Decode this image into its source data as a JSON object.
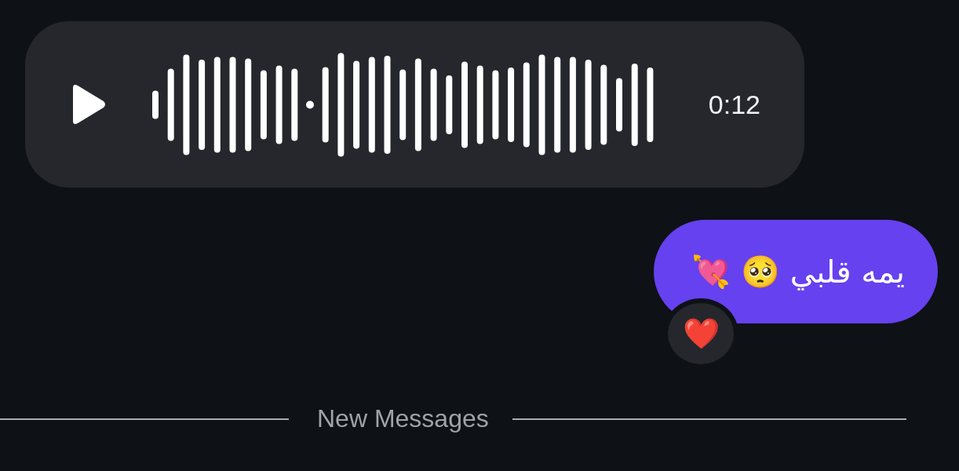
{
  "voice_message": {
    "duration": "0:12"
  },
  "message": {
    "text": "يمه قلبي 🥺 💘",
    "reaction": "❤️"
  },
  "divider": {
    "label": "New Messages"
  }
}
